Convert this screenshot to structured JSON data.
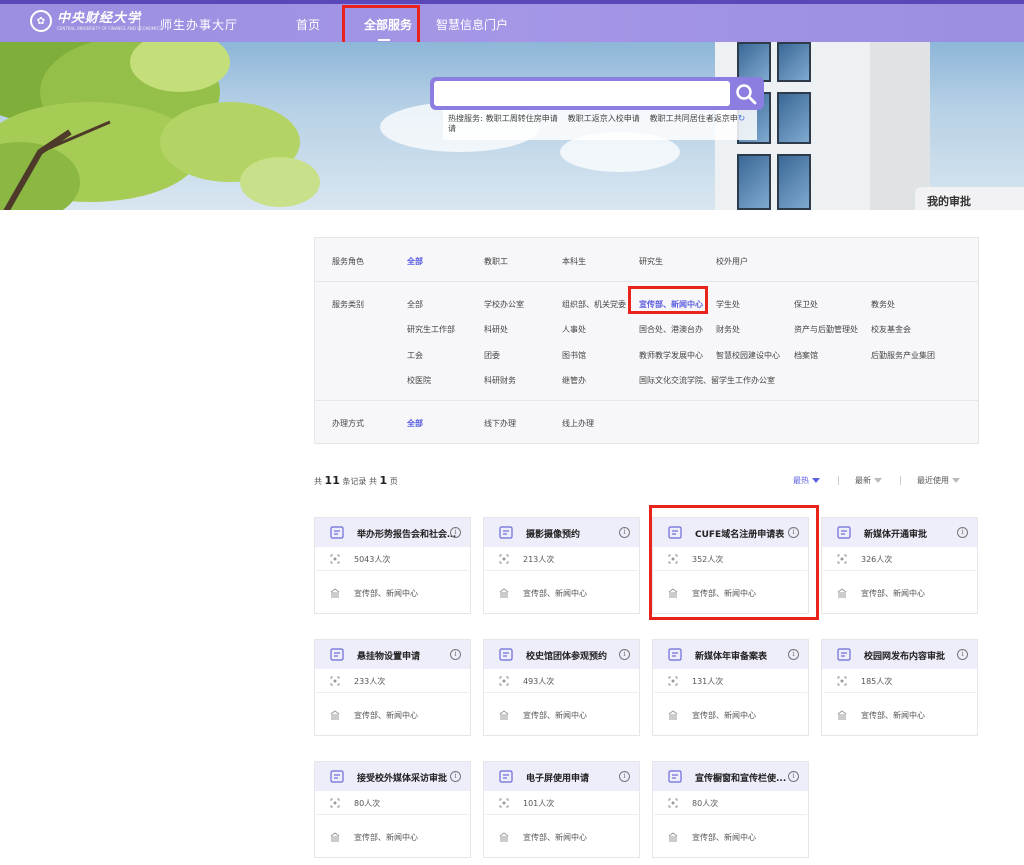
{
  "header": {
    "logo_text": "中央财经大学",
    "logo_subtext": "CENTRAL UNIVERSITY OF FINANCE AND ECONOMICS",
    "portal_title": "师生办事大厅",
    "nav": [
      {
        "label": "首页"
      },
      {
        "label": "全部服务"
      },
      {
        "label": "智慧信息门户"
      }
    ]
  },
  "search": {
    "placeholder": "",
    "hot_label": "热搜服务:",
    "hot_items": [
      "教职工周转住房申请",
      "教职工返京入校申请",
      "教职工共同居住者返京申"
    ],
    "hot_wrap": "请"
  },
  "my_approval": "我的审批",
  "filters": {
    "role": {
      "label": "服务角色",
      "options": [
        "全部",
        "教职工",
        "本科生",
        "研究生",
        "校外用户"
      ],
      "selected": "全部"
    },
    "category": {
      "label": "服务类别",
      "options": [
        "全部",
        "学校办公室",
        "组织部、机关党委",
        "宣传部、新闻中心",
        "学生处",
        "保卫处",
        "教务处",
        "研究生工作部",
        "科研处",
        "人事处",
        "国合处、港澳台办",
        "财务处",
        "资产与后勤管理处",
        "校友基金会",
        "工会",
        "团委",
        "图书馆",
        "教师教学发展中心",
        "智慧校园建设中心",
        "档案馆",
        "后勤服务产业集团",
        "校医院",
        "科研财务",
        "继管办",
        "国际文化交流学院、留学生工作办公室"
      ],
      "selected": "宣传部、新闻中心"
    },
    "method": {
      "label": "办理方式",
      "options": [
        "全部",
        "线下办理",
        "线上办理"
      ],
      "selected": "全部"
    }
  },
  "records": {
    "prefix": "共",
    "count": "11",
    "middle": "条记录 共",
    "pages": "1",
    "suffix": "页"
  },
  "sort": [
    "最热",
    "最新",
    "最近使用"
  ],
  "cards": [
    {
      "title": "举办形势报告会和社会...",
      "count": "5043人次",
      "dept": "宣传部、新闻中心"
    },
    {
      "title": "摄影摄像预约",
      "count": "213人次",
      "dept": "宣传部、新闻中心"
    },
    {
      "title": "CUFE域名注册申请表",
      "count": "352人次",
      "dept": "宣传部、新闻中心"
    },
    {
      "title": "新媒体开通审批",
      "count": "326人次",
      "dept": "宣传部、新闻中心"
    },
    {
      "title": "悬挂物设置申请",
      "count": "233人次",
      "dept": "宣传部、新闻中心"
    },
    {
      "title": "校史馆团体参观预约",
      "count": "493人次",
      "dept": "宣传部、新闻中心"
    },
    {
      "title": "新媒体年审备案表",
      "count": "131人次",
      "dept": "宣传部、新闻中心"
    },
    {
      "title": "校园网发布内容审批",
      "count": "185人次",
      "dept": "宣传部、新闻中心"
    },
    {
      "title": "接受校外媒体采访审批",
      "count": "80人次",
      "dept": "宣传部、新闻中心"
    },
    {
      "title": "电子屏使用申请",
      "count": "101人次",
      "dept": "宣传部、新闻中心"
    },
    {
      "title": "宣传橱窗和宣传栏使...",
      "count": "80人次",
      "dept": "宣传部、新闻中心"
    }
  ],
  "colors": {
    "accent": "#5b5fe0",
    "header": "#9b8ee0",
    "highlight": "#e8231b"
  }
}
